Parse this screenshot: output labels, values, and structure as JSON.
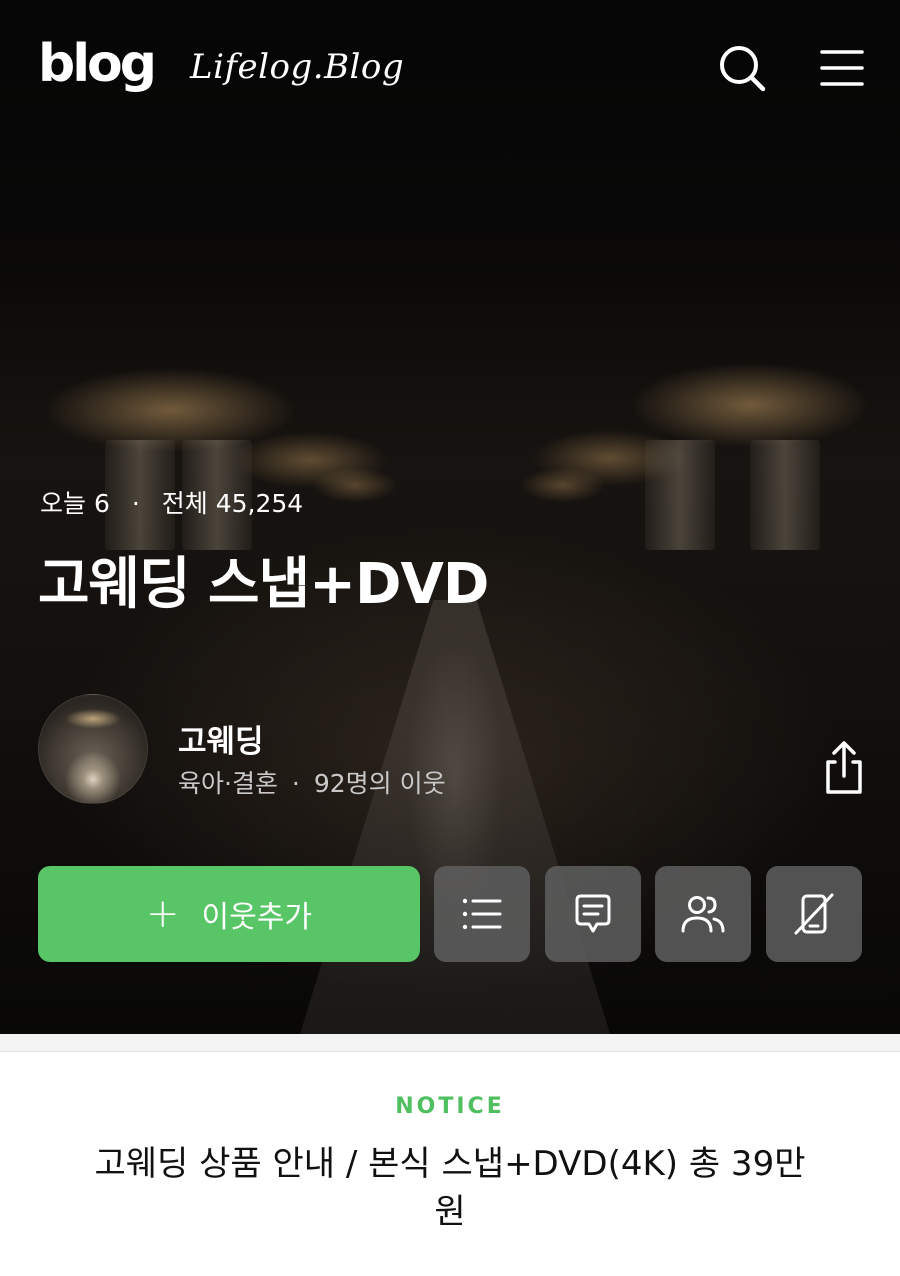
{
  "header": {
    "logo": "blog",
    "blog_name": "Lifelog.Blog",
    "search_icon": "search-icon",
    "menu_icon": "menu-icon"
  },
  "stats": {
    "today_label": "오늘",
    "today_count": "6",
    "separator": "·",
    "total_label": "전체",
    "total_count": "45,254"
  },
  "blog": {
    "title": "고웨딩 스냅+DVD"
  },
  "owner": {
    "name": "고웨딩",
    "category": "육아·결혼",
    "separator": "·",
    "neighbors": "92명의 이웃",
    "share_icon": "share-icon"
  },
  "actions": {
    "add_plus": "+",
    "add_label": "이웃추가",
    "buttons": [
      {
        "icon": "list-icon"
      },
      {
        "icon": "message-icon"
      },
      {
        "icon": "neighbors-icon"
      },
      {
        "icon": "phone-off-icon"
      }
    ]
  },
  "notice": {
    "label": "NOTICE",
    "text": "고웨딩 상품 안내 / 본식 스냅+DVD(4K) 총 39만원"
  },
  "colors": {
    "accent_green": "#58c566",
    "notice_green": "#4fbf5f"
  }
}
